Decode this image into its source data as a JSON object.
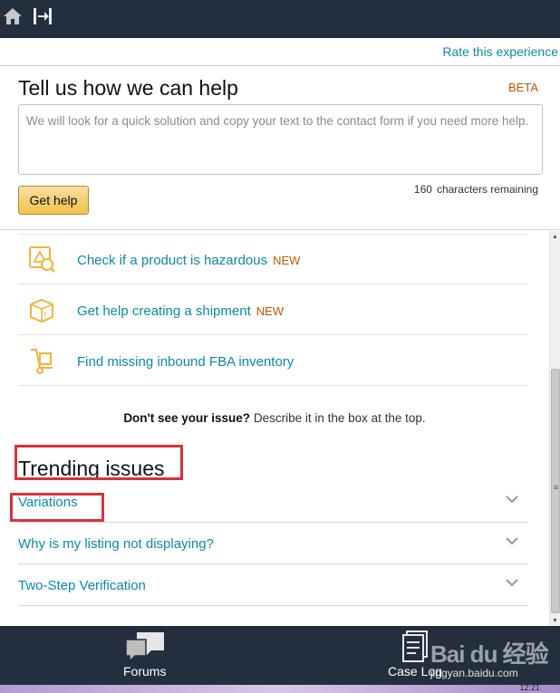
{
  "topbar": {
    "home_icon": "home-icon",
    "exit_icon": "exit-icon"
  },
  "rate_link": "Rate this experience",
  "help": {
    "title": "Tell us how we can help",
    "beta": "BETA",
    "placeholder": "We will look for a quick solution and copy your text to the contact form if you need more help.",
    "button": "Get help",
    "chars_count": "160",
    "chars_label": "characters remaining"
  },
  "list": [
    {
      "label": "Check if a product is hazardous",
      "badge": "NEW",
      "icon": "hazard-search-icon"
    },
    {
      "label": "Get help creating a shipment",
      "badge": "NEW",
      "icon": "shipment-box-icon"
    },
    {
      "label": "Find missing inbound FBA inventory",
      "badge": "",
      "icon": "hand-truck-icon"
    }
  ],
  "dontsee": {
    "bold": "Don't see your issue?",
    "rest": " Describe it in the box at the top."
  },
  "trending": {
    "title": "Trending issues",
    "items": [
      {
        "label": "Variations"
      },
      {
        "label": "Why is my listing not displaying?"
      },
      {
        "label": "Two-Step Verification"
      }
    ]
  },
  "bottom_nav": {
    "forums": "Forums",
    "caselog": "Case Log"
  },
  "watermark": {
    "brand": "Bai du 经验",
    "url": "jingyan.baidu.com"
  },
  "taskbar": {
    "clock": "12:21"
  },
  "colors": {
    "link": "#0a8aa8",
    "badge": "#c45500",
    "nav_bg": "#232f3e",
    "highlight": "#d8323c",
    "button": "#f0c14b"
  }
}
